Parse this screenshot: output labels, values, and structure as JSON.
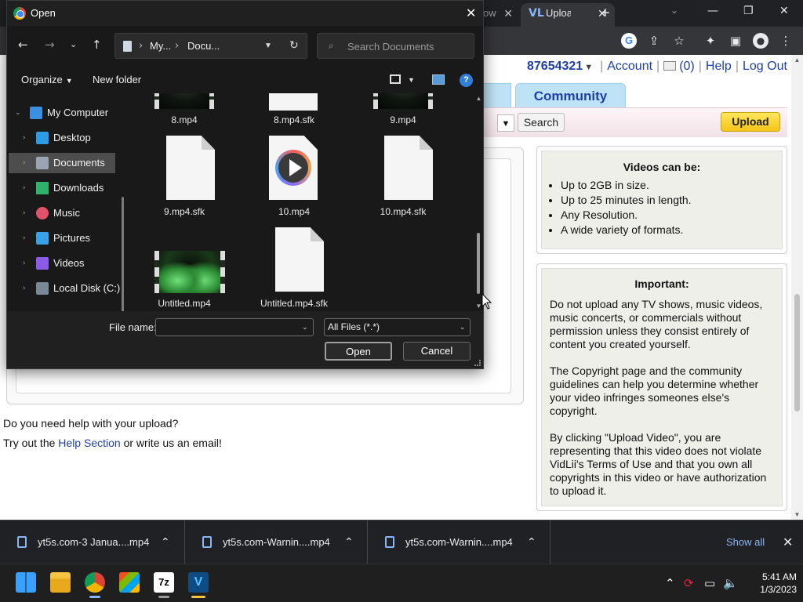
{
  "browser": {
    "tab_partial": "ow",
    "active_tab_title": "Uploa",
    "colors": {
      "tabstrip": "#202124",
      "toolbar": "#35363a"
    }
  },
  "site": {
    "user_id": "87654321",
    "account": "Account",
    "messages_count": "(0)",
    "help": "Help",
    "logout": "Log Out",
    "community_tab": "Community",
    "search_button": "Search",
    "upload_button": "Upload",
    "help_question": "Do you need help with your upload?",
    "help_line_prefix": "Try out the ",
    "help_link": "Help Section",
    "help_line_suffix": " or write us an email!",
    "videos_box": {
      "heading": "Videos can be:",
      "items": [
        "Up to 2GB in size.",
        "Up to 25 minutes in length.",
        "Any Resolution.",
        "A wide variety of formats."
      ]
    },
    "important_box": {
      "heading": "Important:",
      "paragraphs": [
        "Do not upload any TV shows, music videos, music concerts, or commercials without permission unless they consist entirely of content you created yourself.",
        "The Copyright page and the community guidelines can help you determine whether your video infringes someones else's copyright.",
        "By clicking \"Upload Video\", you are representing that this video does not violate VidLii's Terms of Use and that you own all copyrights in this video or have authorization to upload it."
      ]
    }
  },
  "downloads": {
    "items": [
      {
        "name": "yt5s.com-3 Janua....mp4"
      },
      {
        "name": "yt5s.com-Warnin....mp4"
      },
      {
        "name": "yt5s.com-Warnin....mp4"
      }
    ],
    "show_all": "Show all"
  },
  "taskbar": {
    "time": "5:41 AM",
    "date": "1/3/2023",
    "apps": [
      "start",
      "file-explorer",
      "chrome",
      "microsoft-store",
      "7-zip",
      "vidlii"
    ]
  },
  "dialog": {
    "title": "Open",
    "breadcrumb": [
      "My...",
      "Docu..."
    ],
    "search_placeholder": "Search Documents",
    "organize": "Organize",
    "new_folder": "New folder",
    "nav": [
      {
        "label": "My Computer",
        "icon": "computer-icon",
        "expanded": true
      },
      {
        "label": "Desktop",
        "icon": "desktop-icon"
      },
      {
        "label": "Documents",
        "icon": "documents-icon",
        "selected": true
      },
      {
        "label": "Downloads",
        "icon": "downloads-icon"
      },
      {
        "label": "Music",
        "icon": "music-icon"
      },
      {
        "label": "Pictures",
        "icon": "pictures-icon"
      },
      {
        "label": "Videos",
        "icon": "videos-icon"
      },
      {
        "label": "Local Disk (C:)",
        "icon": "local-disk-icon"
      }
    ],
    "files": [
      {
        "name": "8.mp4",
        "kind": "video-thumb"
      },
      {
        "name": "8.mp4.sfk",
        "kind": "doc"
      },
      {
        "name": "9.mp4",
        "kind": "video-thumb"
      },
      {
        "name": "9.mp4.sfk",
        "kind": "doc"
      },
      {
        "name": "10.mp4",
        "kind": "video-player"
      },
      {
        "name": "10.mp4.sfk",
        "kind": "doc"
      },
      {
        "name": "Untitled.mp4",
        "kind": "video-thumb"
      },
      {
        "name": "Untitled.mp4.sfk",
        "kind": "doc"
      }
    ],
    "file_name_label": "File name:",
    "file_name_value": "",
    "file_type": "All Files (*.*)",
    "open_button": "Open",
    "cancel_button": "Cancel"
  }
}
